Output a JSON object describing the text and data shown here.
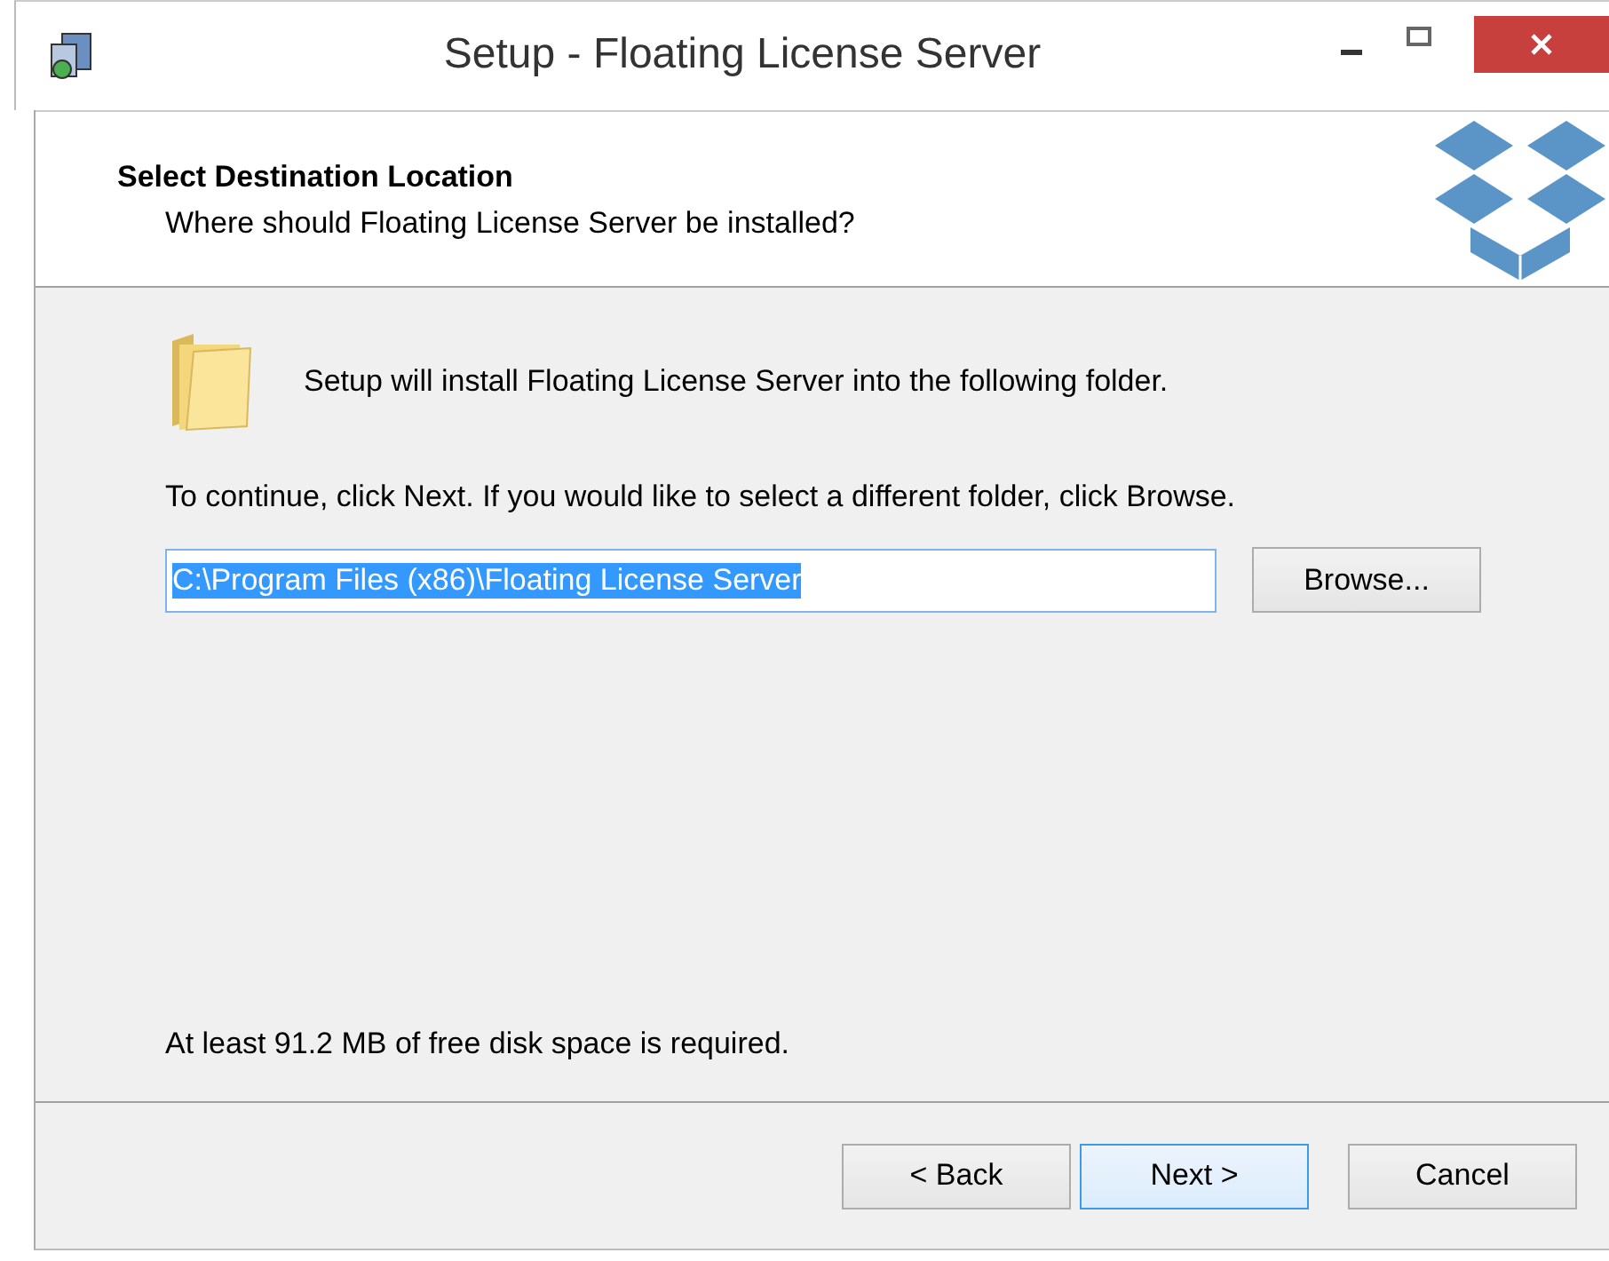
{
  "window": {
    "title": "Setup - Floating License Server"
  },
  "header": {
    "title": "Select Destination Location",
    "subtitle": "Where should Floating License Server be installed?"
  },
  "intro": "Setup will install Floating License Server into the following folder.",
  "instruction": "To continue, click Next. If you would like to select a different folder, click Browse.",
  "path_field": {
    "value": "C:\\Program Files (x86)\\Floating License Server",
    "selected": true
  },
  "browse_button": {
    "label": "Browse...",
    "default": false
  },
  "disk_space": "At least 91.2 MB of free disk space is required.",
  "buttons": [
    {
      "label": "< Back",
      "default": false
    },
    {
      "label": "Next >",
      "default": true
    },
    {
      "label": "Cancel",
      "default": false
    }
  ]
}
